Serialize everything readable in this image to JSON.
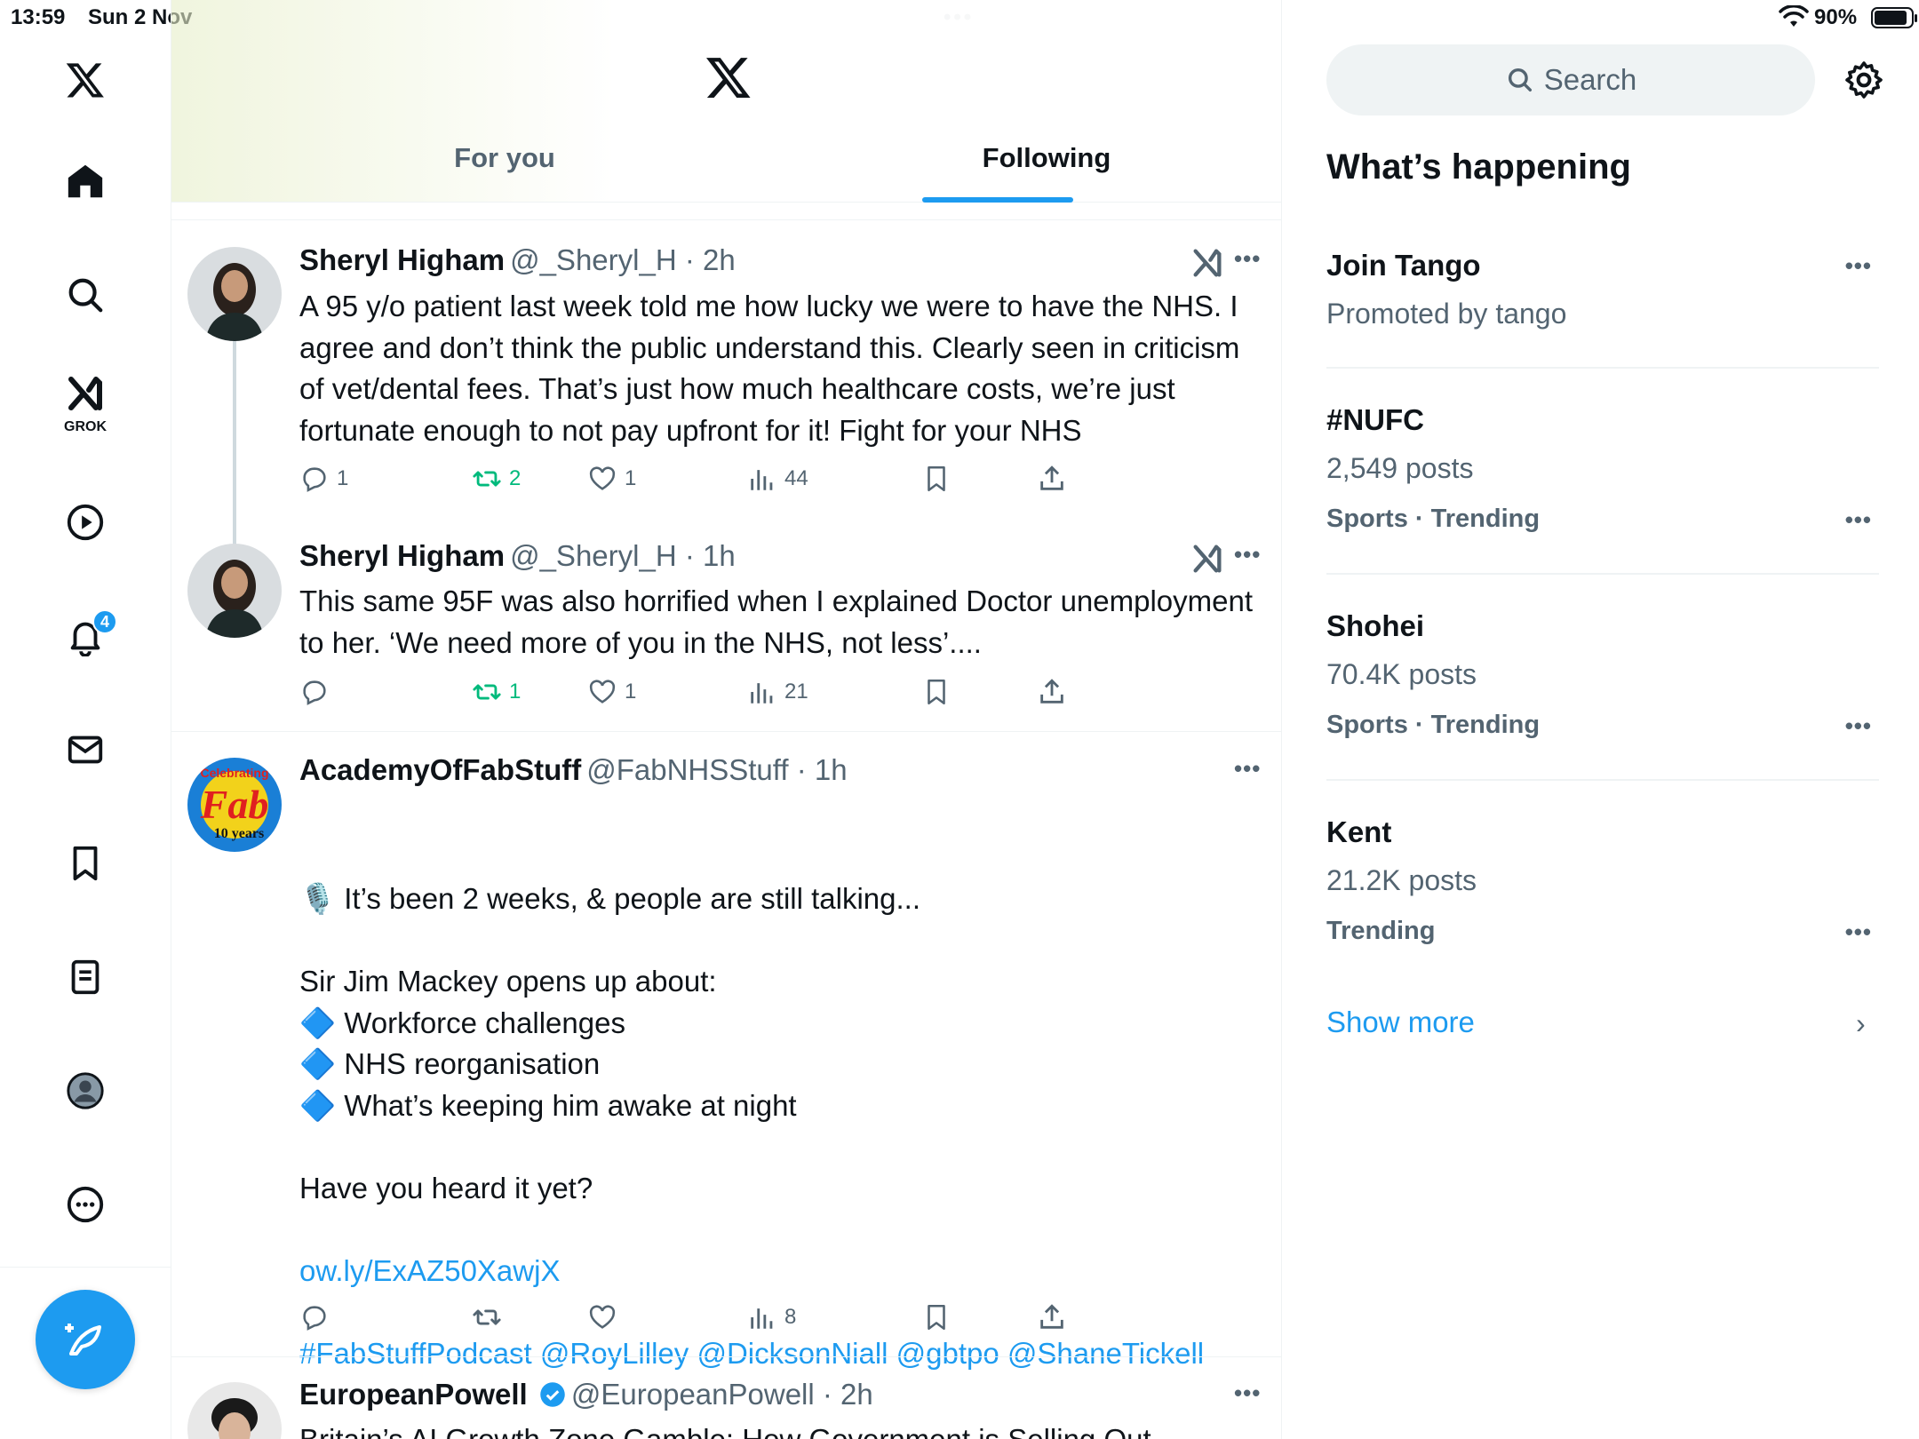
{
  "status_bar": {
    "time": "13:59",
    "date": "Sun 2 Nov",
    "battery": "90%"
  },
  "nav": {
    "grok_label": "GROK",
    "notification_count": "4",
    "icons": [
      "x-logo-icon",
      "home-icon",
      "search-icon",
      "grok-icon",
      "video-icon",
      "bell-icon",
      "mail-icon",
      "bookmark-icon",
      "list-icon",
      "profile-icon",
      "more-icon"
    ]
  },
  "header": {
    "tabs": [
      "For you",
      "Following"
    ],
    "active_tab": "Following"
  },
  "tweets": [
    {
      "name": "Sheryl Higham",
      "handle": "@_Sheryl_H · 2h",
      "body": "A 95 y/o patient last week told me how lucky we were to have the NHS. I agree and don’t think the public understand this. Clearly seen in criticism of vet/dental fees. That’s just how much healthcare costs, we’re just fortunate enough to not pay upfront for it! Fight for your NHS",
      "replies": "1",
      "reposts": "2",
      "likes": "1",
      "views": "44"
    },
    {
      "name": "Sheryl Higham",
      "handle": "@_Sheryl_H · 1h",
      "body": "This same 95F was also horrified when I explained Doctor unemployment to her. ‘We need more of you in the NHS, not less’....",
      "replies": "",
      "reposts": "1",
      "likes": "1",
      "views": "21"
    },
    {
      "name": "AcademyOfFabStuff",
      "handle": "@FabNHSStuff · 1h",
      "avatar_text": [
        "Celebrating",
        "Fab",
        "10 years"
      ],
      "body_lines": [
        "🎙️ It’s been 2 weeks, & people are still talking...",
        "",
        "Sir Jim Mackey opens up about:",
        "🔷 Workforce challenges",
        "🔷 NHS reorganisation",
        "🔷 What’s keeping him awake at night",
        "",
        "Have you heard it yet?",
        ""
      ],
      "link": "ow.ly/ExAZ50XawjX",
      "tags": "#FabStuffPodcast @RoyLilley @DicksonNiall @gbtpo @ShaneTickell",
      "replies": "",
      "reposts": "",
      "likes": "",
      "views": "8"
    },
    {
      "name": "EuropeanPowell",
      "handle": "@EuropeanPowell · 2h",
      "body": "Britain’s AI Growth Zone Gamble: How Government is Selling Out"
    }
  ],
  "sidebar": {
    "search_placeholder": "Search",
    "title": "What’s happening",
    "trends": [
      {
        "name": "Join Tango",
        "sub": "Promoted by tango",
        "meta": ""
      },
      {
        "name": "#NUFC",
        "sub": "2,549 posts",
        "meta": "Sports · Trending"
      },
      {
        "name": "Shohei",
        "sub": "70.4K posts",
        "meta": "Sports · Trending"
      },
      {
        "name": "Kent",
        "sub": "21.2K posts",
        "meta": "Trending"
      }
    ],
    "show_more": "Show more"
  },
  "colors": {
    "accent": "#1d9bf0",
    "repost_green": "#00ba7c",
    "muted": "#536471"
  }
}
